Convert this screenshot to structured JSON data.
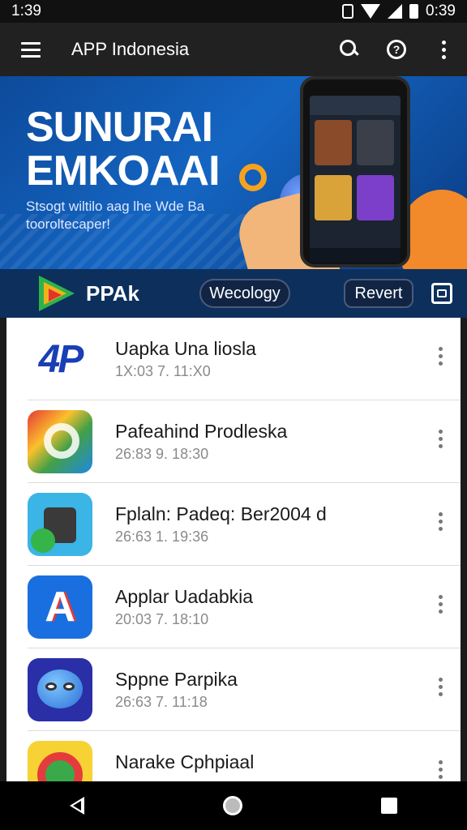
{
  "status_bar": {
    "time": "1:39",
    "battery_time": "0:39"
  },
  "app_bar": {
    "title": "APP Indonesia"
  },
  "banner": {
    "headline_line1": "SUNURAI",
    "headline_line2": "EMKOAAI",
    "subtext_line1": "Stsogt wiltilo aag lhe Wde Ba",
    "subtext_line2": "tooroltecaper!"
  },
  "brand_strip": {
    "name": "PPAk",
    "primary_button": "Wecology",
    "secondary_button": "Revert"
  },
  "apps": [
    {
      "title": "Uapka Una liosla",
      "meta": "1X:03 7. 11:X0",
      "icon": "4p-logo-icon"
    },
    {
      "title": "Pafeahind Prodleska",
      "meta": "26:83 9. 18:30",
      "icon": "colorful-g-icon"
    },
    {
      "title": "Fplaln: Padeq: Ber2004 d",
      "meta": "26:63 1. 19:36",
      "icon": "robot-icon"
    },
    {
      "title": "Applar Uadabkia",
      "meta": "20:03 7. 18:10",
      "icon": "letter-a-icon"
    },
    {
      "title": "Sppne Parpika",
      "meta": "26:63 7. 11:18",
      "icon": "blue-blob-icon"
    },
    {
      "title": "Narake Cphpiaal",
      "meta": "",
      "icon": "target-icon"
    }
  ],
  "colors": {
    "app_bar_bg": "#212121",
    "banner_blue": "#1465c2",
    "brand_strip_bg": "#0d2f5c",
    "list_bg": "#ffffff"
  }
}
